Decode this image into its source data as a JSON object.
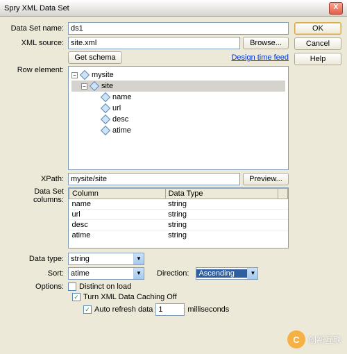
{
  "title": "Spry XML Data Set",
  "buttons": {
    "ok": "OK",
    "cancel": "Cancel",
    "help": "Help",
    "browse": "Browse...",
    "getschema": "Get schema",
    "preview": "Preview...",
    "close": "X"
  },
  "links": {
    "designtime": "Design time feed"
  },
  "labels": {
    "dsname": "Data Set name:",
    "xmlsource": "XML source:",
    "rowelement": "Row element:",
    "xpath": "XPath:",
    "dscolumns": "Data Set columns:",
    "datatype": "Data type:",
    "sort": "Sort:",
    "direction": "Direction:",
    "options": "Options:"
  },
  "fields": {
    "dsname": "ds1",
    "xmlsource": "site.xml",
    "xpath": "mysite/site",
    "datatype": "string",
    "sort": "atime",
    "direction": "Ascending",
    "refreshval": "1"
  },
  "tree": {
    "root": "mysite",
    "child": "site",
    "leaves": [
      "name",
      "url",
      "desc",
      "atime"
    ]
  },
  "grid": {
    "headers": {
      "col": "Column",
      "type": "Data Type"
    },
    "rows": [
      {
        "col": "name",
        "type": "string"
      },
      {
        "col": "url",
        "type": "string"
      },
      {
        "col": "desc",
        "type": "string"
      },
      {
        "col": "atime",
        "type": "string"
      }
    ]
  },
  "options": {
    "distinct": "Distinct on load",
    "caching": "Turn XML Data Caching Off",
    "autorefresh_pre": "Auto refresh data",
    "autorefresh_post": "milliseconds"
  },
  "watermark": "创新互联"
}
